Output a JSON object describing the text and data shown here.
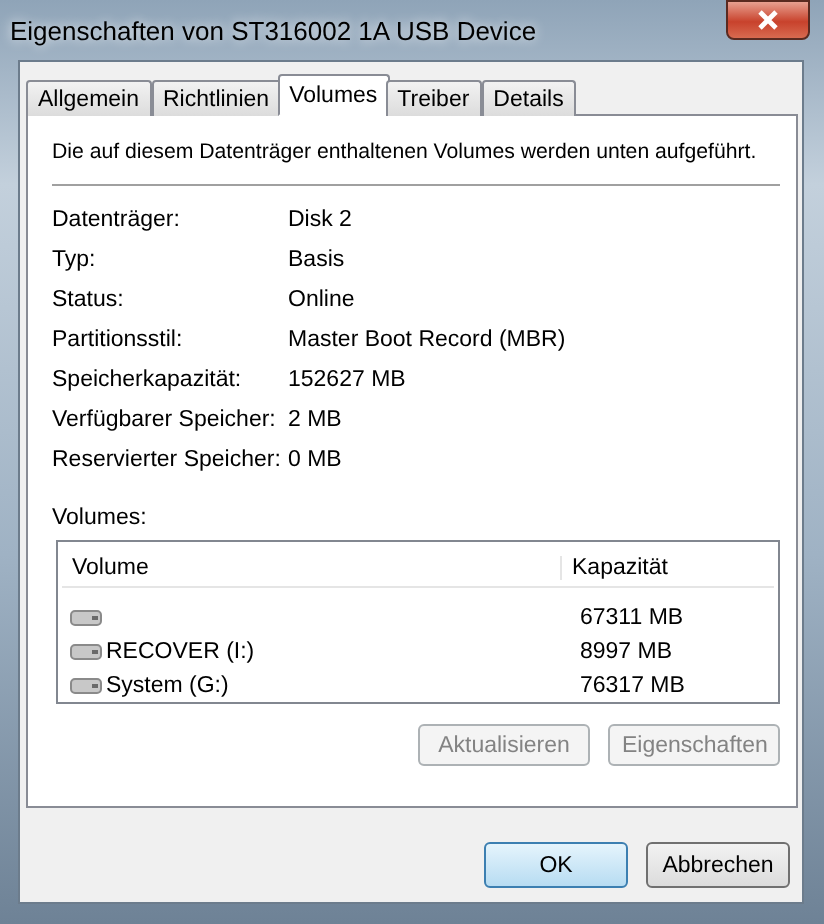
{
  "window": {
    "title": "Eigenschaften von ST316002 1A USB Device"
  },
  "tabs": [
    {
      "label": "Allgemein",
      "selected": false
    },
    {
      "label": "Richtlinien",
      "selected": false
    },
    {
      "label": "Volumes",
      "selected": true
    },
    {
      "label": "Treiber",
      "selected": false
    },
    {
      "label": "Details",
      "selected": false
    }
  ],
  "description": "Die auf diesem Datenträger enthaltenen Volumes werden unten aufgeführt.",
  "properties": [
    {
      "label": "Datenträger:",
      "value": "Disk 2"
    },
    {
      "label": "Typ:",
      "value": "Basis"
    },
    {
      "label": "Status:",
      "value": "Online"
    },
    {
      "label": "Partitionsstil:",
      "value": "Master Boot Record (MBR)"
    },
    {
      "label": "Speicherkapazität:",
      "value": "152627 MB"
    },
    {
      "label": "Verfügbarer Speicher:",
      "value": "2 MB"
    },
    {
      "label": "Reservierter Speicher:",
      "value": "0 MB"
    }
  ],
  "volumes": {
    "label": "Volumes:",
    "columns": [
      "Volume",
      "Kapazität"
    ],
    "rows": [
      {
        "name": "",
        "capacity": "67311 MB"
      },
      {
        "name": "RECOVER (I:)",
        "capacity": "8997 MB"
      },
      {
        "name": "System (G:)",
        "capacity": "76317 MB"
      }
    ]
  },
  "panel_buttons": [
    {
      "label": "Aktualisieren",
      "disabled": true
    },
    {
      "label": "Eigenschaften",
      "disabled": true
    }
  ],
  "buttons": [
    {
      "label": "OK",
      "default": true
    },
    {
      "label": "Abbrechen",
      "default": false
    }
  ]
}
